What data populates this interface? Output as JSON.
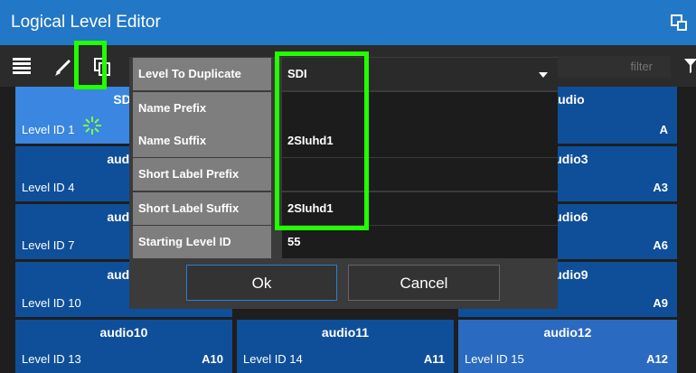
{
  "window": {
    "title": "Logical Level Editor"
  },
  "toolbar": {
    "filter_placeholder": "filter"
  },
  "levels": [
    {
      "name": "SDI",
      "id": "Level ID 1",
      "label": ""
    },
    {
      "name": "audio",
      "id": "Level ID 4",
      "label": ""
    },
    {
      "name": "audio",
      "id": "Level ID 7",
      "label": ""
    },
    {
      "name": "audio",
      "id": "Level ID 10",
      "label": ""
    },
    {
      "name": "audio10",
      "id": "Level ID 13",
      "label": "A10"
    },
    {
      "name": "audio11",
      "id": "Level ID 14",
      "label": "A11"
    },
    {
      "name": "audio12",
      "id": "Level ID 15",
      "label": "A12"
    },
    {
      "name": "audio",
      "id": "",
      "label": "A"
    },
    {
      "name": "audio3",
      "id": "",
      "label": "A3"
    },
    {
      "name": "audio6",
      "id": "",
      "label": "A6"
    },
    {
      "name": "audio9",
      "id": "",
      "label": "A9"
    }
  ],
  "dialog": {
    "fields": [
      {
        "label": "Level To Duplicate",
        "value": "SDI"
      },
      {
        "label": "Name Prefix",
        "value": ""
      },
      {
        "label": "Name Suffix",
        "value": "2SIuhd1"
      },
      {
        "label": "Short Label Prefix",
        "value": ""
      },
      {
        "label": "Short Label Suffix",
        "value": "2SIuhd1"
      },
      {
        "label": "Starting Level ID",
        "value": "55"
      }
    ],
    "ok_label": "Ok",
    "cancel_label": "Cancel"
  },
  "colors": {
    "accent": "#2277c6",
    "tile": "#0f4f99",
    "tile_selected": "#3a86e0",
    "highlight": "#22ff00"
  },
  "icons": [
    "list-icon",
    "edit-icon",
    "duplicate-icon",
    "popout-icon",
    "filter-icon",
    "spinner-icon",
    "dropdown-arrow-icon"
  ]
}
